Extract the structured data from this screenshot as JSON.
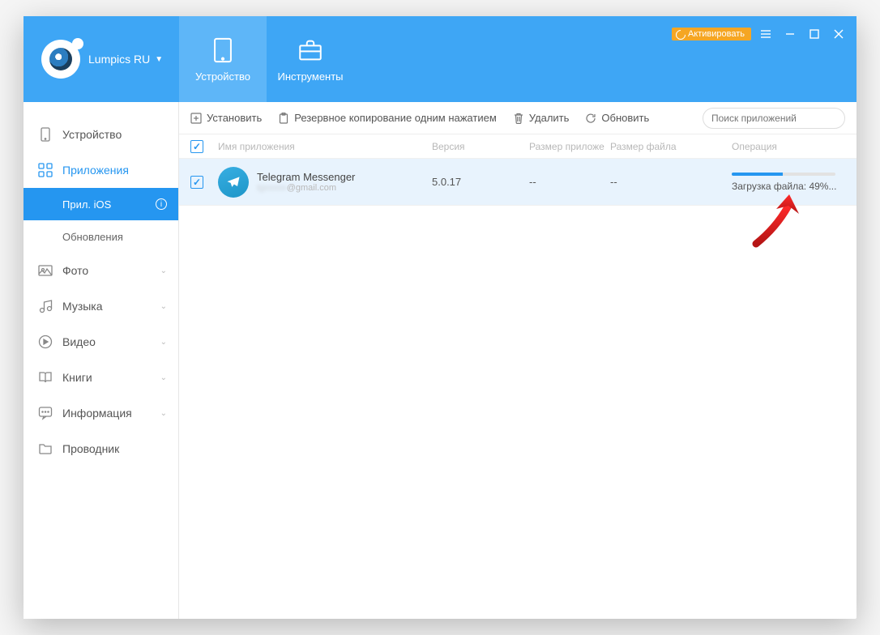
{
  "header": {
    "brand_name": "Lumpics RU",
    "tab_device": "Устройство",
    "tab_tools": "Инструменты",
    "activate": "Активировать"
  },
  "sidebar": {
    "device": "Устройство",
    "apps": "Приложения",
    "apps_ios": "Прил. iOS",
    "updates": "Обновления",
    "photo": "Фото",
    "music": "Музыка",
    "video": "Видео",
    "books": "Книги",
    "info": "Информация",
    "finder": "Проводник"
  },
  "toolbar": {
    "install": "Установить",
    "backup": "Резервное копирование одним нажатием",
    "delete": "Удалить",
    "refresh": "Обновить",
    "search_placeholder": "Поиск приложений"
  },
  "cols": {
    "name": "Имя приложения",
    "version": "Версия",
    "appsize": "Размер приложе",
    "filesize": "Размер файла",
    "operation": "Операция"
  },
  "row": {
    "app_name": "Telegram Messenger",
    "app_sub_suffix": "@gmail.com",
    "version": "5.0.17",
    "appsize": "--",
    "filesize": "--",
    "op_text": "Загрузка файла: 49%...",
    "progress_percent": 49
  }
}
